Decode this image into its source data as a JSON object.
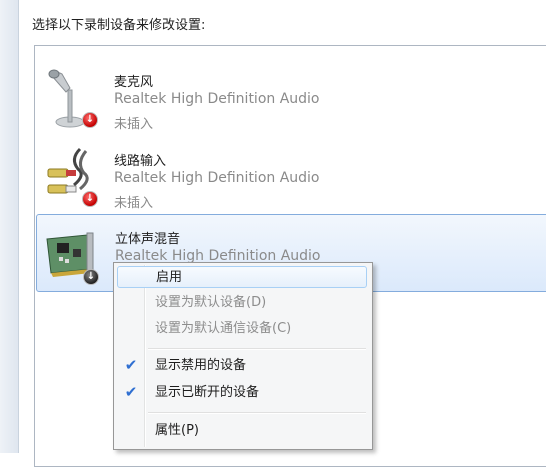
{
  "instruction": "选择以下录制设备来修改设置:",
  "devices": [
    {
      "name": "麦克风",
      "driver": "Realtek High Definition Audio",
      "status": "未插入",
      "icon": "microphone-icon"
    },
    {
      "name": "线路输入",
      "driver": "Realtek High Definition Audio",
      "status": "未插入",
      "icon": "line-in-cable-icon"
    },
    {
      "name": "立体声混音",
      "driver": "Realtek High Definition Audio",
      "status": "",
      "icon": "sound-card-icon"
    }
  ],
  "context_menu": {
    "items": [
      {
        "label": "启用"
      },
      {
        "label": "设置为默认设备(D)"
      },
      {
        "label": "设置为默认通信设备(C)"
      },
      {
        "label": "显示禁用的设备"
      },
      {
        "label": "显示已断开的设备"
      },
      {
        "label": "属性(P)"
      }
    ],
    "check_glyph": "✔"
  }
}
